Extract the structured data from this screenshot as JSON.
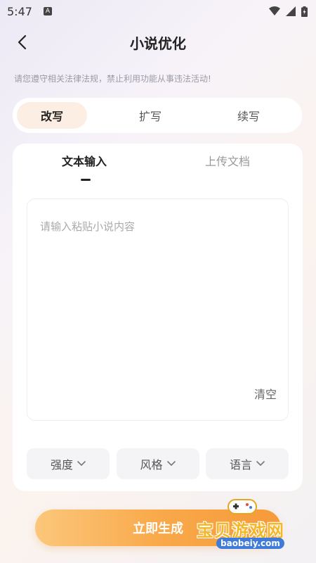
{
  "status": {
    "time": "5:47",
    "badge": "A"
  },
  "header": {
    "title": "小说优化"
  },
  "notice": "请您遵守相关法律法规，禁止利用功能从事违法活动!",
  "mode_tabs": [
    {
      "label": "改写",
      "active": true
    },
    {
      "label": "扩写",
      "active": false
    },
    {
      "label": "续写",
      "active": false
    }
  ],
  "input_tabs": [
    {
      "label": "文本输入",
      "active": true
    },
    {
      "label": "上传文档",
      "active": false
    }
  ],
  "text_input": {
    "placeholder": "请输入粘贴小说内容",
    "value": ""
  },
  "clear_label": "清空",
  "options": [
    {
      "label": "强度"
    },
    {
      "label": "风格"
    },
    {
      "label": "语言"
    }
  ],
  "generate_label": "立即生成",
  "watermark": {
    "text": "宝贝游戏网",
    "url": "baobeiy.com"
  },
  "colors": {
    "accent": "#f9a94a",
    "active_tab_bg": "#fdeee4"
  }
}
